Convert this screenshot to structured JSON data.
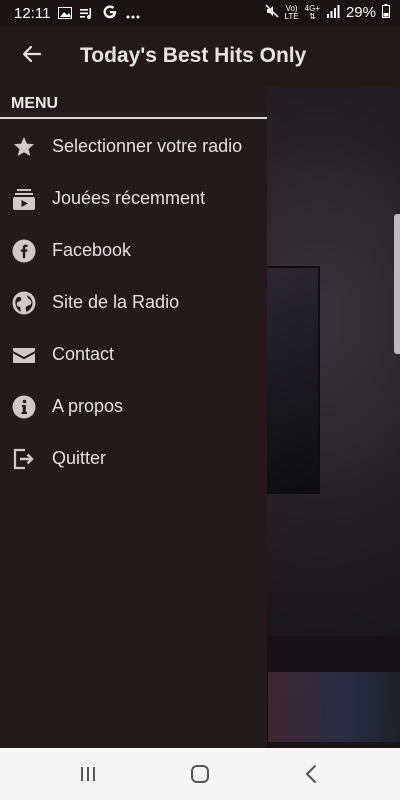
{
  "status": {
    "time": "12:11",
    "battery": "29%",
    "net_top": "4G+",
    "lte": "LTE",
    "vol": "Vo)",
    "icons": [
      "image-icon",
      "media-icon",
      "google-icon",
      "more-icon",
      "mute-icon",
      "signal-icon",
      "battery-icon"
    ]
  },
  "appbar": {
    "title": "Today's Best Hits Only"
  },
  "menu": {
    "header": "MENU",
    "items": [
      {
        "label": "Selectionner votre radio",
        "icon": "star-icon"
      },
      {
        "label": "Jouées récemment",
        "icon": "playlist-icon"
      },
      {
        "label": "Facebook",
        "icon": "facebook-icon"
      },
      {
        "label": "Site de la Radio",
        "icon": "globe-icon"
      },
      {
        "label": "Contact",
        "icon": "mail-icon"
      },
      {
        "label": "A propos",
        "icon": "info-icon"
      },
      {
        "label": "Quitter",
        "icon": "exit-icon"
      }
    ]
  },
  "colors": {
    "drawer_bg": "#231a1b",
    "appbar_bg": "#231919",
    "text": "#e6e0e0",
    "icon": "#cfc9c9"
  }
}
